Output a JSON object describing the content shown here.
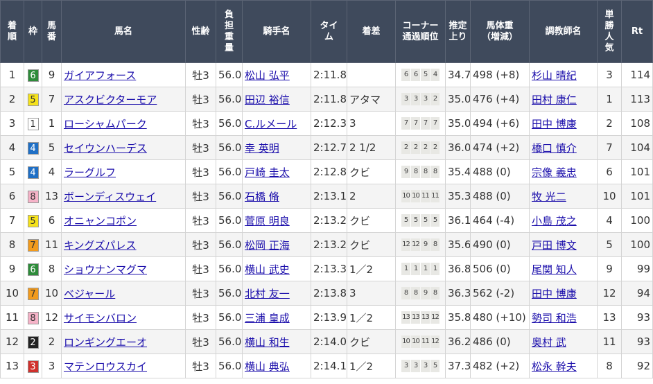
{
  "headers": {
    "rank": "着順",
    "waku": "枠",
    "umaban": "馬番",
    "horse": "馬名",
    "sex_age": "性齢",
    "weight_carried": "負担重量",
    "jockey": "騎手名",
    "time": "タイム",
    "margin": "着差",
    "corner": "コーナー通過順位",
    "last3f": "推定上り",
    "body_weight": "馬体重（増減）",
    "trainer": "調教師名",
    "popularity": "単勝人気",
    "rating": "Rt"
  },
  "waku_colors": {
    "1": {
      "bg": "#ffffff",
      "fg": "#333333"
    },
    "2": {
      "bg": "#222222",
      "fg": "#ffffff"
    },
    "3": {
      "bg": "#d0312d",
      "fg": "#ffffff"
    },
    "4": {
      "bg": "#1f6fc5",
      "fg": "#ffffff"
    },
    "5": {
      "bg": "#f5e21b",
      "fg": "#333333"
    },
    "6": {
      "bg": "#2e8b3a",
      "fg": "#ffffff"
    },
    "7": {
      "bg": "#f29b1d",
      "fg": "#333333"
    },
    "8": {
      "bg": "#f6b3c8",
      "fg": "#333333"
    }
  },
  "rows": [
    {
      "rank": "1",
      "waku": "6",
      "umaban": "9",
      "horse": "ガイアフォース",
      "sex_age": "牡3",
      "weight_carried": "56.0",
      "jockey": "松山 弘平",
      "time": "2:11.8",
      "margin": "",
      "corner": [
        "6",
        "6",
        "5",
        "4"
      ],
      "last3f": "34.7",
      "body_weight": "498 (+8)",
      "trainer": "杉山 晴紀",
      "popularity": "3",
      "rating": "114"
    },
    {
      "rank": "2",
      "waku": "5",
      "umaban": "7",
      "horse": "アスクビクターモア",
      "sex_age": "牡3",
      "weight_carried": "56.0",
      "jockey": "田辺 裕信",
      "time": "2:11.8",
      "margin": "アタマ",
      "corner": [
        "3",
        "3",
        "3",
        "2"
      ],
      "last3f": "35.0",
      "body_weight": "476 (+4)",
      "trainer": "田村 康仁",
      "popularity": "1",
      "rating": "113"
    },
    {
      "rank": "3",
      "waku": "1",
      "umaban": "1",
      "horse": "ローシャムパーク",
      "sex_age": "牡3",
      "weight_carried": "56.0",
      "jockey": "C.ルメール",
      "time": "2:12.3",
      "margin": "3",
      "corner": [
        "7",
        "7",
        "7",
        "7"
      ],
      "last3f": "35.0",
      "body_weight": "494 (+6)",
      "trainer": "田中 博康",
      "popularity": "2",
      "rating": "108"
    },
    {
      "rank": "4",
      "waku": "4",
      "umaban": "5",
      "horse": "セイウンハーデス",
      "sex_age": "牡3",
      "weight_carried": "56.0",
      "jockey": "幸 英明",
      "time": "2:12.7",
      "margin": "2 1/2",
      "corner": [
        "2",
        "2",
        "2",
        "2"
      ],
      "last3f": "36.0",
      "body_weight": "474 (+2)",
      "trainer": "橋口 慎介",
      "popularity": "7",
      "rating": "104"
    },
    {
      "rank": "5",
      "waku": "4",
      "umaban": "4",
      "horse": "ラーグルフ",
      "sex_age": "牡3",
      "weight_carried": "56.0",
      "jockey": "戸崎 圭太",
      "time": "2:12.8",
      "margin": "クビ",
      "corner": [
        "9",
        "8",
        "8",
        "8"
      ],
      "last3f": "35.4",
      "body_weight": "488 (0)",
      "trainer": "宗像 義忠",
      "popularity": "6",
      "rating": "101"
    },
    {
      "rank": "6",
      "waku": "8",
      "umaban": "13",
      "horse": "ボーンディスウェイ",
      "sex_age": "牡3",
      "weight_carried": "56.0",
      "jockey": "石橋 脩",
      "time": "2:13.1",
      "margin": "2",
      "corner": [
        "10",
        "10",
        "11",
        "11"
      ],
      "last3f": "35.3",
      "body_weight": "488 (0)",
      "trainer": "牧 光二",
      "popularity": "10",
      "rating": "101"
    },
    {
      "rank": "7",
      "waku": "5",
      "umaban": "6",
      "horse": "オニャンコポン",
      "sex_age": "牡3",
      "weight_carried": "56.0",
      "jockey": "菅原 明良",
      "time": "2:13.2",
      "margin": "クビ",
      "corner": [
        "5",
        "5",
        "5",
        "5"
      ],
      "last3f": "36.1",
      "body_weight": "464 (-4)",
      "trainer": "小島 茂之",
      "popularity": "4",
      "rating": "100"
    },
    {
      "rank": "8",
      "waku": "7",
      "umaban": "11",
      "horse": "キングズパレス",
      "sex_age": "牡3",
      "weight_carried": "56.0",
      "jockey": "松岡 正海",
      "time": "2:13.2",
      "margin": "クビ",
      "corner": [
        "12",
        "12",
        "9",
        "8"
      ],
      "last3f": "35.6",
      "body_weight": "490 (0)",
      "trainer": "戸田 博文",
      "popularity": "5",
      "rating": "100"
    },
    {
      "rank": "9",
      "waku": "6",
      "umaban": "8",
      "horse": "ショウナンマグマ",
      "sex_age": "牡3",
      "weight_carried": "56.0",
      "jockey": "横山 武史",
      "time": "2:13.3",
      "margin": "1／2",
      "corner": [
        "1",
        "1",
        "1",
        "1"
      ],
      "last3f": "36.8",
      "body_weight": "506 (0)",
      "trainer": "尾関 知人",
      "popularity": "9",
      "rating": "99"
    },
    {
      "rank": "10",
      "waku": "7",
      "umaban": "10",
      "horse": "ベジャール",
      "sex_age": "牡3",
      "weight_carried": "56.0",
      "jockey": "北村 友一",
      "time": "2:13.8",
      "margin": "3",
      "corner": [
        "8",
        "8",
        "9",
        "8"
      ],
      "last3f": "36.3",
      "body_weight": "562 (-2)",
      "trainer": "田中 博康",
      "popularity": "12",
      "rating": "94"
    },
    {
      "rank": "11",
      "waku": "8",
      "umaban": "12",
      "horse": "サイモンバロン",
      "sex_age": "牡3",
      "weight_carried": "56.0",
      "jockey": "三浦 皇成",
      "time": "2:13.9",
      "margin": "1／2",
      "corner": [
        "13",
        "13",
        "13",
        "12"
      ],
      "last3f": "35.8",
      "body_weight": "480 (+10)",
      "trainer": "勢司 和浩",
      "popularity": "13",
      "rating": "93"
    },
    {
      "rank": "12",
      "waku": "2",
      "umaban": "2",
      "horse": "ロンギングエーオ",
      "sex_age": "牡3",
      "weight_carried": "56.0",
      "jockey": "横山 和生",
      "time": "2:14.0",
      "margin": "クビ",
      "corner": [
        "10",
        "10",
        "11",
        "12"
      ],
      "last3f": "36.2",
      "body_weight": "486 (0)",
      "trainer": "奥村 武",
      "popularity": "11",
      "rating": "93"
    },
    {
      "rank": "13",
      "waku": "3",
      "umaban": "3",
      "horse": "マテンロウスカイ",
      "sex_age": "牡3",
      "weight_carried": "56.0",
      "jockey": "横山 典弘",
      "time": "2:14.1",
      "margin": "1／2",
      "corner": [
        "3",
        "3",
        "3",
        "5"
      ],
      "last3f": "37.3",
      "body_weight": "482 (+2)",
      "trainer": "松永 幹夫",
      "popularity": "8",
      "rating": "92"
    }
  ]
}
